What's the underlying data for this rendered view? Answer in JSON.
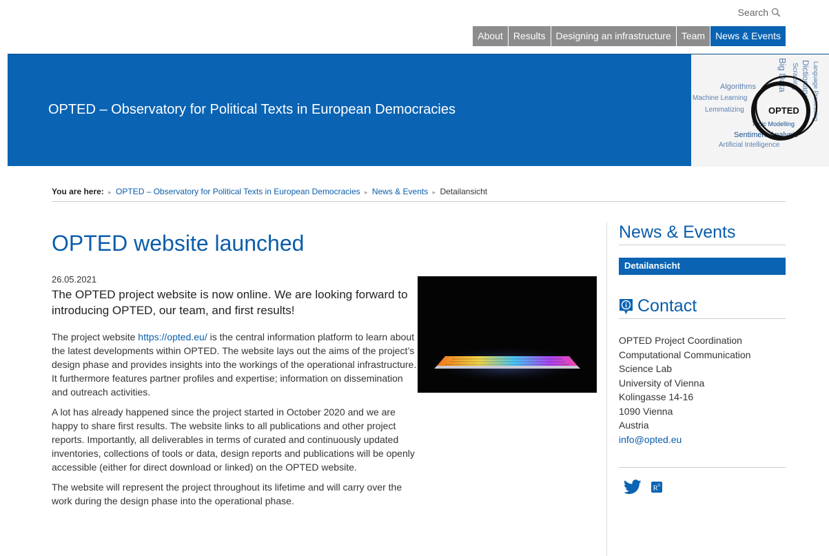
{
  "search": {
    "label": "Search"
  },
  "nav": {
    "items": [
      {
        "label": "About"
      },
      {
        "label": "Results"
      },
      {
        "label": "Designing an infrastructure"
      },
      {
        "label": "Team"
      },
      {
        "label": "News & Events"
      }
    ],
    "active_index": 4
  },
  "banner": {
    "title": "OPTED – Observatory for Political Texts in European Democracies",
    "logo_text": "OPTED",
    "logo_words": [
      "Algorithms",
      "Machine Learning",
      "Lemmatizing",
      "Topic Modelling",
      "Sentiment Analysis",
      "Artificial Intelligence",
      "Big Data",
      "Scraping",
      "Dictionary",
      "Language Processing"
    ]
  },
  "breadcrumb": {
    "prefix": "You are here:",
    "items": [
      {
        "label": "OPTED – Observatory for Political Texts in European Democracies"
      },
      {
        "label": "News & Events"
      },
      {
        "label": "Detailansicht"
      }
    ]
  },
  "article": {
    "title": "OPTED website launched",
    "date": "26.05.2021",
    "lead": "The OPTED project website is now online. We are looking forward to introducing OPTED, our team, and first results!",
    "p1_before": "The project website ",
    "p1_link": "https://opted.eu/",
    "p1_after": " is the central information platform to learn about the latest developments within OPTED. The website lays out the aims of the project’s design phase and provides insights into the workings of the operational infrastructure. It furthermore features partner profiles and expertise; information on dissemination and outreach activities.",
    "p2": "A lot has already happened since the project started in October 2020 and we are happy to share first results. The website links to all publications and other project reports. Importantly, all deliverables in terms of curated and continuously updated inventories, collections of tools or data, design reports and publications will be openly accessible (either for direct download or linked) on the OPTED website.",
    "p3": "The website will represent the project throughout its lifetime and will carry over the work during the design phase into the operational phase."
  },
  "sidebar": {
    "news_heading": "News & Events",
    "news_active": "Detailansicht",
    "contact_heading": "Contact",
    "address": [
      "OPTED Project Coordination",
      "Computational Communication",
      "Science Lab",
      "University of Vienna",
      "Kolingasse 14-16",
      "1090 Vienna",
      "Austria"
    ],
    "email": "info@opted.eu"
  },
  "colors": {
    "accent": "#0a63b3",
    "nav_gray": "#8c8c8c"
  }
}
